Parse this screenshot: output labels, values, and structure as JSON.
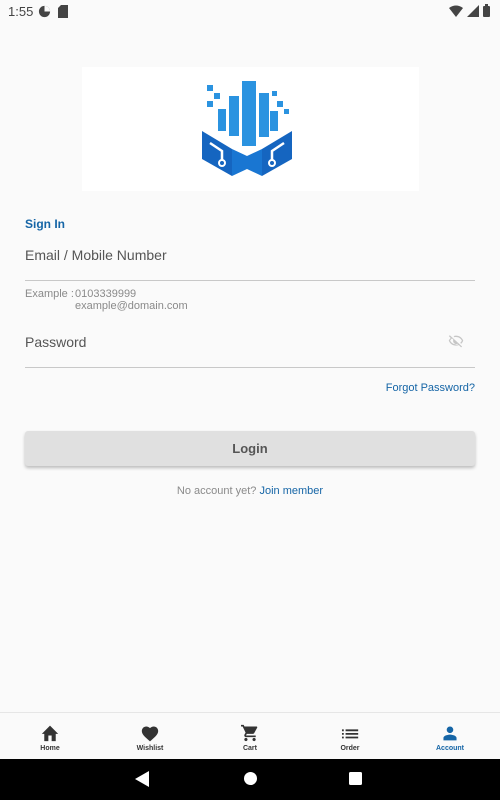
{
  "status_bar": {
    "time": "1:55",
    "icons": [
      "data-saver-icon",
      "sim-card-icon",
      "wifi-icon",
      "signal-icon",
      "battery-icon"
    ]
  },
  "logo": {
    "icon": "building-circuit-logo",
    "colors": [
      "#2b93e0",
      "#1565c0"
    ]
  },
  "form": {
    "title": "Sign In",
    "email_label": "Email / Mobile Number",
    "example_prefix": "Example :",
    "example_phone": "0103339999",
    "example_email": "example@domain.com",
    "password_label": "Password",
    "forgot_password": "Forgot Password?",
    "login_button": "Login",
    "no_account": "No account yet?",
    "join_member": "Join member"
  },
  "bottom_nav": {
    "items": [
      {
        "label": "Home",
        "icon": "home-icon",
        "active": false
      },
      {
        "label": "Wishlist",
        "icon": "heart-icon",
        "active": false
      },
      {
        "label": "Cart",
        "icon": "cart-icon",
        "active": false
      },
      {
        "label": "Order",
        "icon": "list-icon",
        "active": false
      },
      {
        "label": "Account",
        "icon": "person-icon",
        "active": true
      }
    ]
  },
  "colors": {
    "accent": "#1565a6",
    "background": "#fafafa",
    "button_bg": "#e0e0e0"
  }
}
